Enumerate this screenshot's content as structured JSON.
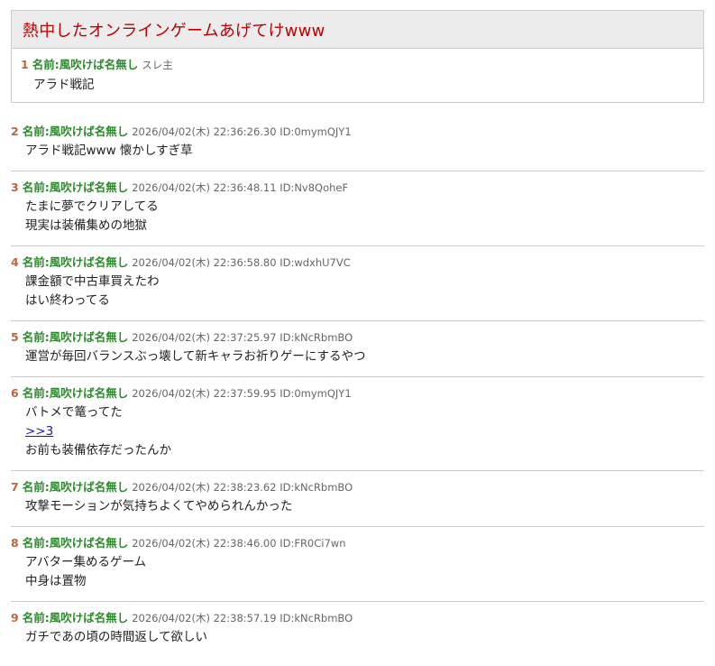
{
  "thread": {
    "title": "熱中したオンラインゲームあげてけwww",
    "op": {
      "num": "1",
      "name": "名前:風吹けば名無し",
      "meta": "スレ主",
      "lines": [
        "アラド戦記"
      ]
    }
  },
  "replies": [
    {
      "num": "2",
      "name": "名前:風吹けば名無し",
      "meta": "2026/04/02(木) 22:36:26.30 ID:0mymQJY1",
      "lines": [
        "アラド戦記www 懐かしすぎ草"
      ]
    },
    {
      "num": "3",
      "name": "名前:風吹けば名無し",
      "meta": "2026/04/02(木) 22:36:48.11 ID:Nv8QoheF",
      "lines": [
        "たまに夢でクリアしてる",
        "現実は装備集めの地獄"
      ]
    },
    {
      "num": "4",
      "name": "名前:風吹けば名無し",
      "meta": "2026/04/02(木) 22:36:58.80 ID:wdxhU7VC",
      "lines": [
        "課金額で中古車買えたわ",
        "はい終わってる"
      ]
    },
    {
      "num": "5",
      "name": "名前:風吹けば名無し",
      "meta": "2026/04/02(木) 22:37:25.97 ID:kNcRbmBO",
      "lines": [
        "運営が毎回バランスぶっ壊して新キャラお祈りゲーにするやつ"
      ]
    },
    {
      "num": "6",
      "name": "名前:風吹けば名無し",
      "meta": "2026/04/02(木) 22:37:59.95 ID:0mymQJY1",
      "lines": [
        "バトメで篭ってた",
        ">>3",
        "お前も装備依存だったんか"
      ]
    },
    {
      "num": "7",
      "name": "名前:風吹けば名無し",
      "meta": "2026/04/02(木) 22:38:23.62 ID:kNcRbmBO",
      "lines": [
        "攻撃モーションが気持ちよくてやめられんかった"
      ]
    },
    {
      "num": "8",
      "name": "名前:風吹けば名無し",
      "meta": "2026/04/02(木) 22:38:46.00 ID:FR0Ci7wn",
      "lines": [
        "アバター集めるゲーム",
        "中身は置物"
      ]
    },
    {
      "num": "9",
      "name": "名前:風吹けば名無し",
      "meta": "2026/04/02(木) 22:38:57.19 ID:kNcRbmBO",
      "lines": [
        "ガチであの頃の時間返して欲しい"
      ]
    }
  ]
}
